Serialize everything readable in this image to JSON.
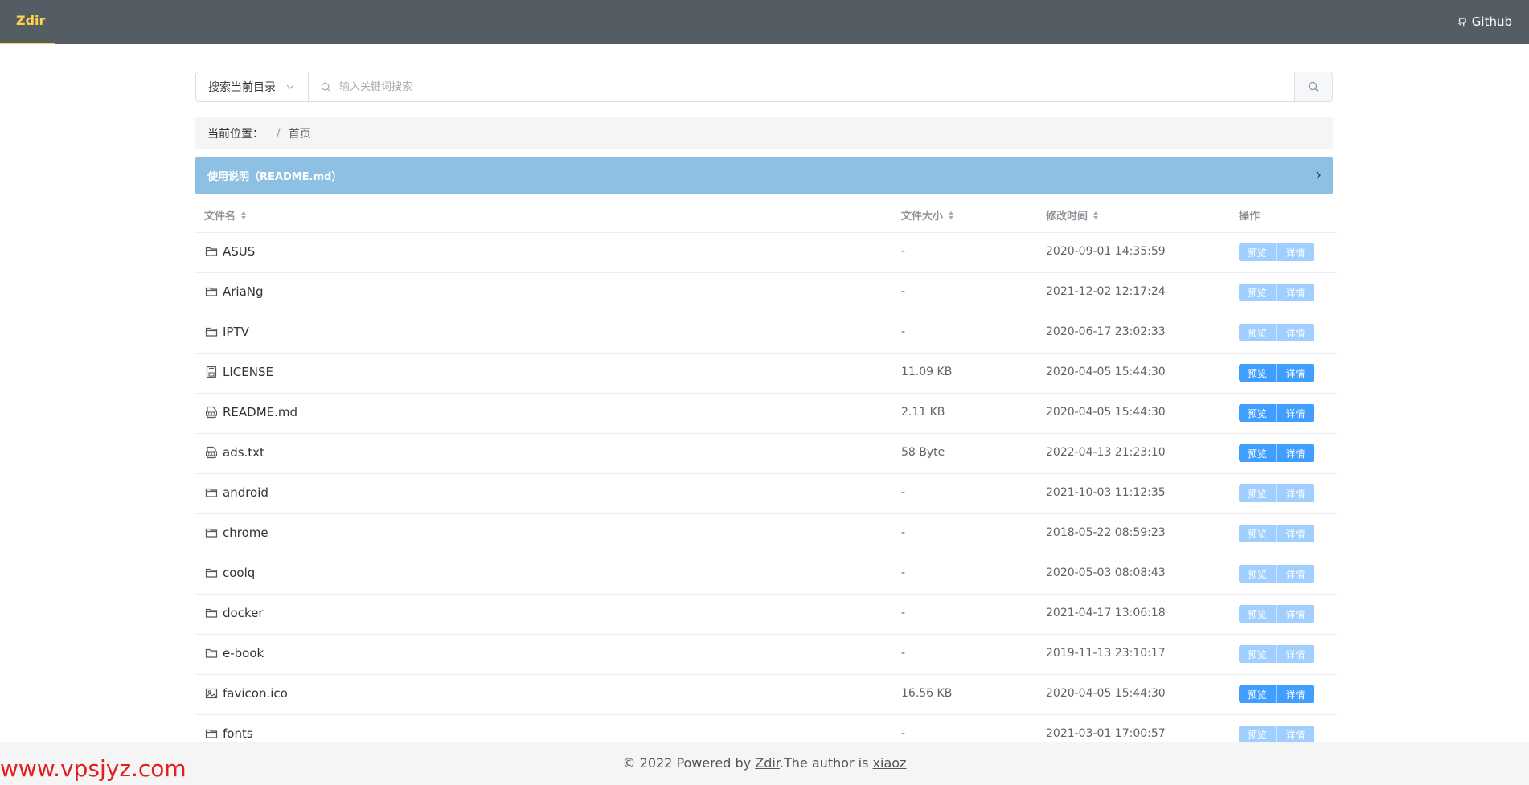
{
  "header": {
    "brand": "Zdir",
    "github_label": "Github",
    "colors": {
      "bar": "#545c64",
      "brand": "#ffd04b"
    }
  },
  "search": {
    "scope_label": "搜索当前目录",
    "placeholder": "输入关键词搜索"
  },
  "breadcrumb": {
    "label": "当前位置：",
    "separator": "/",
    "current": "首页"
  },
  "readme": {
    "title": "使用说明（README.md）"
  },
  "table": {
    "headers": {
      "name": "文件名",
      "size": "文件大小",
      "time": "修改时间",
      "ops": "操作"
    },
    "rows": [
      {
        "icon": "folder-icon",
        "name": "ASUS",
        "size": "-",
        "time": "2020-09-01 14:35:59",
        "enabled": false
      },
      {
        "icon": "folder-icon",
        "name": "AriaNg",
        "size": "-",
        "time": "2021-12-02 12:17:24",
        "enabled": false
      },
      {
        "icon": "folder-icon",
        "name": "IPTV",
        "size": "-",
        "time": "2020-06-17 23:02:33",
        "enabled": false
      },
      {
        "icon": "file-icon",
        "name": "LICENSE",
        "size": "11.09 KB",
        "time": "2020-04-05 15:44:30",
        "enabled": true
      },
      {
        "icon": "txt-file-icon",
        "name": "README.md",
        "size": "2.11 KB",
        "time": "2020-04-05 15:44:30",
        "enabled": true
      },
      {
        "icon": "txt-file-icon",
        "name": "ads.txt",
        "size": "58 Byte",
        "time": "2022-04-13 21:23:10",
        "enabled": true
      },
      {
        "icon": "folder-icon",
        "name": "android",
        "size": "-",
        "time": "2021-10-03 11:12:35",
        "enabled": false
      },
      {
        "icon": "folder-icon",
        "name": "chrome",
        "size": "-",
        "time": "2018-05-22 08:59:23",
        "enabled": false
      },
      {
        "icon": "folder-icon",
        "name": "coolq",
        "size": "-",
        "time": "2020-05-03 08:08:43",
        "enabled": false
      },
      {
        "icon": "folder-icon",
        "name": "docker",
        "size": "-",
        "time": "2021-04-17 13:06:18",
        "enabled": false
      },
      {
        "icon": "folder-icon",
        "name": "e-book",
        "size": "-",
        "time": "2019-11-13 23:10:17",
        "enabled": false
      },
      {
        "icon": "image-icon",
        "name": "favicon.ico",
        "size": "16.56 KB",
        "time": "2020-04-05 15:44:30",
        "enabled": true
      },
      {
        "icon": "folder-icon",
        "name": "fonts",
        "size": "-",
        "time": "2021-03-01 17:00:57",
        "enabled": false
      }
    ],
    "actions": {
      "preview": "预览",
      "details": "详情"
    },
    "colors": {
      "button_active": "#409eff",
      "button_disabled": "#a0cfff"
    }
  },
  "footer": {
    "prefix": "© 2022 Powered by ",
    "powered_link": "Zdir",
    "middle": ".The author is ",
    "author_link": "xiaoz"
  },
  "watermark": "www.vpsjyz.com"
}
